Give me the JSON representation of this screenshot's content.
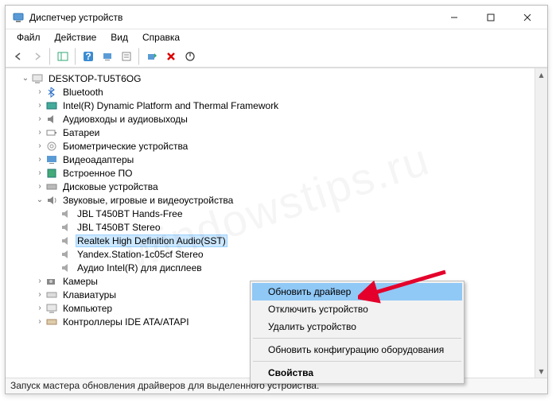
{
  "window": {
    "title": "Диспетчер устройств"
  },
  "menu": {
    "file": "Файл",
    "action": "Действие",
    "view": "Вид",
    "help": "Справка"
  },
  "tree": {
    "root": "DESKTOP-TU5T6OG",
    "bluetooth": "Bluetooth",
    "intel_dptf": "Intel(R) Dynamic Platform and Thermal Framework",
    "audio_io": "Аудиовходы и аудиовыходы",
    "batteries": "Батареи",
    "biometric": "Биометрические устройства",
    "video_adapters": "Видеоадаптеры",
    "firmware": "Встроенное ПО",
    "disk": "Дисковые устройства",
    "sound": "Звуковые, игровые и видеоустройства",
    "sound_items": {
      "jbl_hf": "JBL T450BT Hands-Free",
      "jbl_st": "JBL T450BT Stereo",
      "realtek": "Realtek High Definition Audio(SST)",
      "yandex": "Yandex.Station-1c05cf Stereo",
      "intel_disp": "Аудио Intel(R) для дисплеев"
    },
    "cameras": "Камеры",
    "keyboards": "Клавиатуры",
    "computer": "Компьютер",
    "ide": "Контроллеры IDE ATA/ATAPI"
  },
  "context_menu": {
    "update": "Обновить драйвер",
    "disable": "Отключить устройство",
    "uninstall": "Удалить устройство",
    "scan": "Обновить конфигурацию оборудования",
    "properties": "Свойства"
  },
  "statusbar": "Запуск мастера обновления драйверов для выделенного устройства.",
  "watermark": "windowstips.ru"
}
